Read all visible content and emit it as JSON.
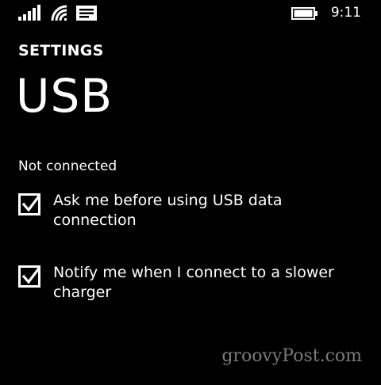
{
  "status_bar": {
    "time": "9:11",
    "icons": [
      "signal-strength-icon",
      "wifi-icon",
      "message-icon",
      "battery-icon"
    ]
  },
  "header": {
    "section": "SETTINGS",
    "title": "USB"
  },
  "connection_status": "Not connected",
  "options": [
    {
      "label": "Ask me before using USB data connection",
      "checked": true
    },
    {
      "label": "Notify me when I connect to a slower charger",
      "checked": true
    }
  ],
  "watermark": "groovyPost.com",
  "colors": {
    "background": "#000000",
    "foreground": "#ffffff",
    "watermark": "#7a7a7a"
  }
}
